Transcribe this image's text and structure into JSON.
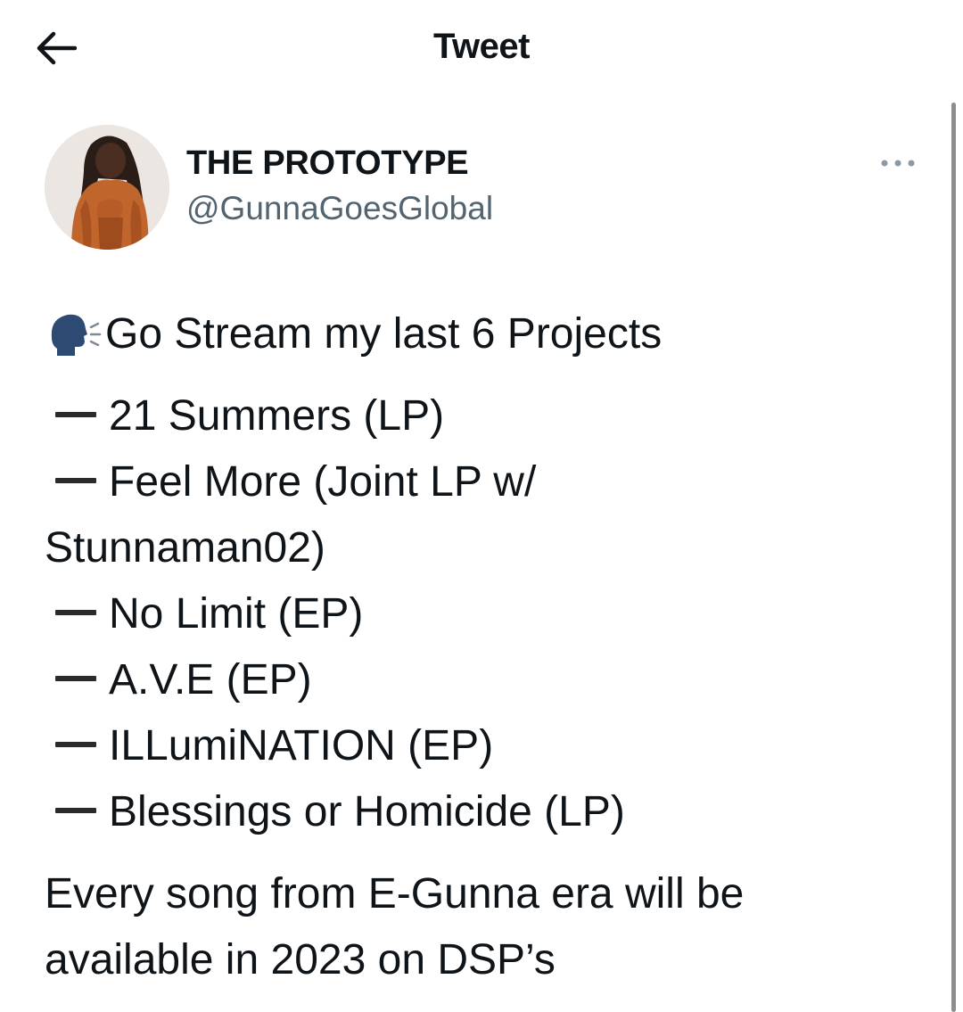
{
  "header": {
    "title": "Tweet"
  },
  "author": {
    "name": "THE PROTOTYPE",
    "handle": "@GunnaGoesGlobal"
  },
  "tweet": {
    "intro": "Go Stream my last 6 Projects",
    "projects": [
      "21 Summers (LP)",
      "Feel More (Joint LP w/",
      "Stunnaman02)",
      "No Limit (EP)",
      "A.V.E (EP)",
      "ILLumiNATION (EP)",
      "Blessings or Homicide (LP)"
    ],
    "outro": "Every song from E-Gunna era will be available in 2023 on DSP’s"
  },
  "icons": {
    "back": "back-arrow-icon",
    "more": "more-options-icon",
    "speaking": "speaking-head-icon"
  },
  "colors": {
    "text": "#0f1419",
    "secondary_text": "#536471",
    "scrollbar": "#8e8e8e"
  }
}
